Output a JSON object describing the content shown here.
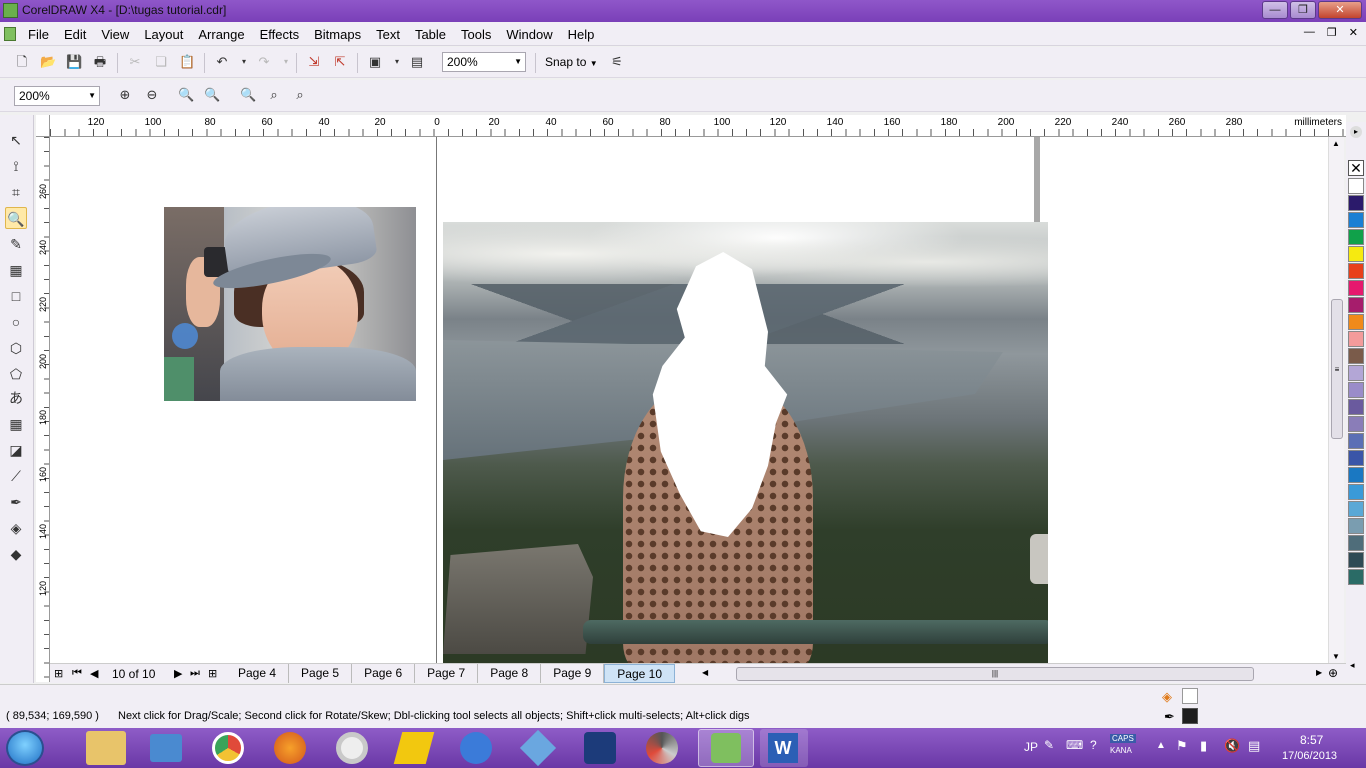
{
  "window": {
    "title": "CorelDRAW X4 - [D:\\tugas tutorial.cdr]",
    "buttons": {
      "minimize": "—",
      "restore": "❐",
      "close": "✕"
    }
  },
  "menu": {
    "items": [
      "File",
      "Edit",
      "View",
      "Layout",
      "Arrange",
      "Effects",
      "Bitmaps",
      "Text",
      "Table",
      "Tools",
      "Window",
      "Help"
    ]
  },
  "toolbar": {
    "zoom_level": "200%",
    "snap_to": "Snap to"
  },
  "zoom_toolbar": {
    "zoom_level": "200%"
  },
  "ruler": {
    "unit": "millimeters",
    "h_ticks": [
      "120",
      "100",
      "80",
      "60",
      "40",
      "20",
      "0",
      "20",
      "40",
      "60",
      "80",
      "100",
      "120",
      "140",
      "160",
      "180",
      "200",
      "220",
      "240",
      "260",
      "280"
    ],
    "v_ticks": [
      "260",
      "240",
      "220",
      "200",
      "180",
      "160",
      "140",
      "120"
    ]
  },
  "page_nav": {
    "counter": "10 of 10",
    "tabs": [
      "Page 4",
      "Page 5",
      "Page 6",
      "Page 7",
      "Page 8",
      "Page 9",
      "Page 10"
    ],
    "active_tab": "Page 10"
  },
  "status": {
    "coordinates": "( 89,534; 169,590 )",
    "hint": "Next click for Drag/Scale; Second click for Rotate/Skew; Dbl-clicking tool selects all objects; Shift+click multi-selects; Alt+click digs"
  },
  "palette": {
    "colors": [
      "#ffffff",
      "#2b1a6b",
      "#1a7fd4",
      "#10a14a",
      "#f6ea10",
      "#e8401b",
      "#e6196e",
      "#a61d6c",
      "#f08a1a",
      "#f39b9b",
      "#7a5b4a",
      "#b3a6d6",
      "#9a8cc9",
      "#6a5a9e",
      "#8a7db8",
      "#5b6fb5",
      "#3a55a8",
      "#1a78c2",
      "#3a9ad8",
      "#5aa8d6",
      "#7a9db0",
      "#4f6d7a",
      "#2f4a55",
      "#2a6b66"
    ]
  },
  "taskbar": {
    "language": "JP",
    "caps_label": "CAPS",
    "kana_label": "KANA",
    "time": "8:57",
    "date": "17/06/2013"
  }
}
